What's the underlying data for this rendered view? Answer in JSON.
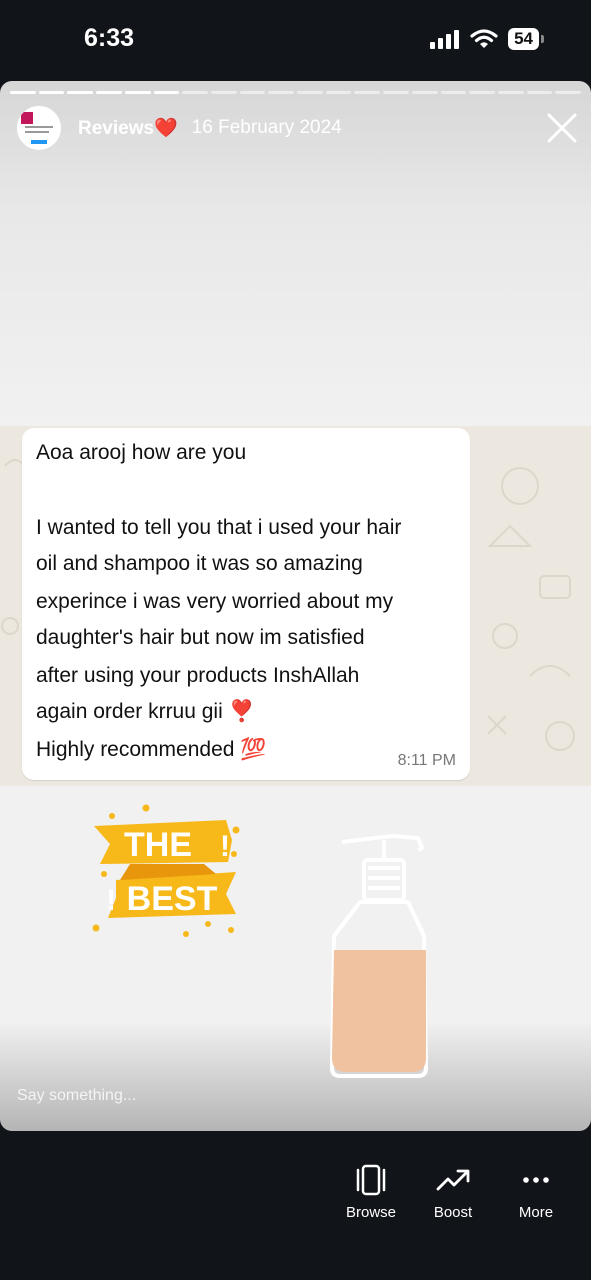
{
  "status_bar": {
    "time": "6:33",
    "battery": "54"
  },
  "story": {
    "name": "Reviews",
    "name_emoji": "❤️",
    "date": "16 February 2024",
    "progress_total": 20,
    "progress_done": 6
  },
  "message": {
    "lines": [
      "Aoa arooj how are you",
      "",
      "I wanted to tell you that i used your hair",
      "oil and shampoo it was so amazing",
      "experince i was very worried about my",
      "daughter's hair but now im satisfied",
      "after using your products InshAllah",
      "again order krruu gii ❣️",
      "Highly recommended 💯"
    ],
    "time": "8:11 PM"
  },
  "sticker_best": {
    "line1": "THE",
    "line2": "BEST"
  },
  "reply": {
    "placeholder": "Say something..."
  },
  "nav": {
    "browse": "Browse",
    "boost": "Boost",
    "more": "More"
  },
  "colors": {
    "background": "#111418",
    "sticker_yellow": "#f7b81a",
    "bottle_fill": "#f0c2a0"
  }
}
